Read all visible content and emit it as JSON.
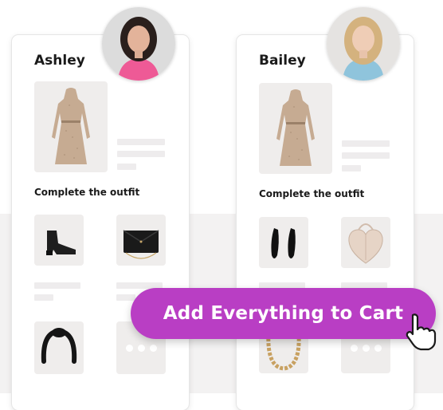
{
  "cards": [
    {
      "name": "Ashley",
      "section_label": "Complete the outfit"
    },
    {
      "name": "Bailey",
      "section_label": "Complete the outfit"
    }
  ],
  "cta": {
    "label": "Add Everything to Cart"
  },
  "colors": {
    "accent": "#b93ec4",
    "placeholder": "#eeeced",
    "thumb_bg": "#efedec"
  },
  "icons": {
    "avatar_a": "avatar-photo-icon",
    "avatar_b": "avatar-photo-icon",
    "main_product": "dress-icon",
    "card_a_items": [
      "ankle-boot-icon",
      "clutch-bag-icon",
      "headband-icon",
      "more-dots-icon"
    ],
    "card_b_items": [
      "flat-shoes-icon",
      "heart-bag-icon",
      "chain-necklace-icon",
      "more-dots-icon"
    ],
    "pointer": "hand-cursor-icon"
  }
}
